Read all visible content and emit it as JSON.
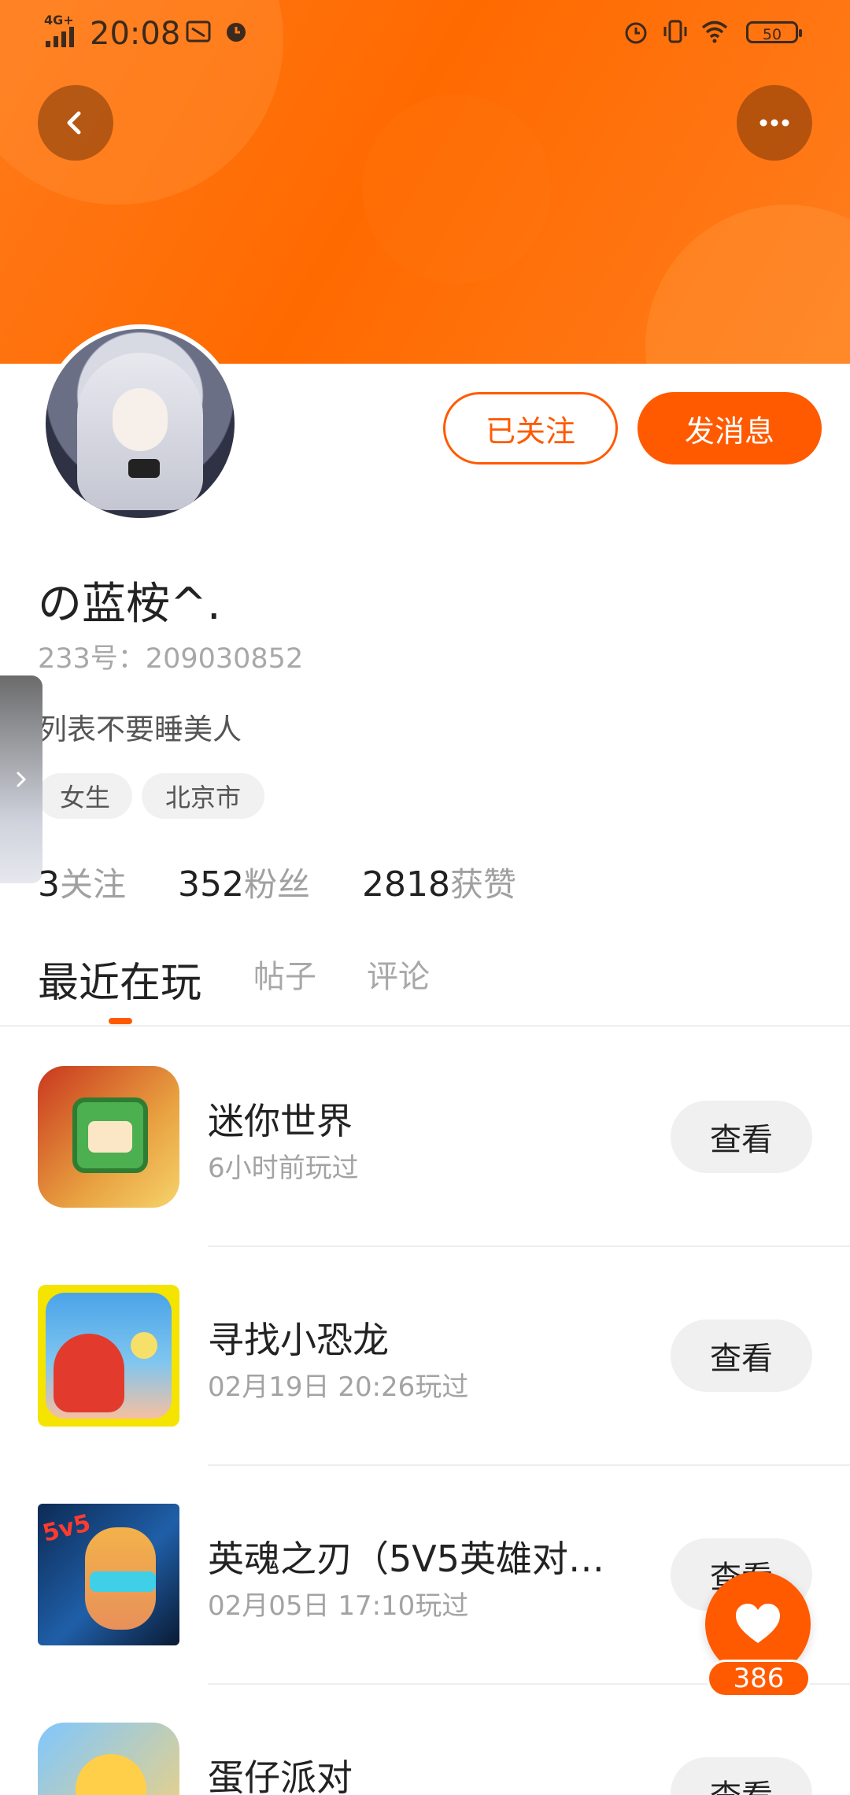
{
  "status_bar": {
    "network": "4G+",
    "time": "20:08",
    "battery": "50"
  },
  "header": {
    "back_icon": "chevron-left-icon",
    "more_icon": "more-dots-icon"
  },
  "profile": {
    "follow_label": "已关注",
    "message_label": "发消息",
    "name": "の蓝桉^.",
    "id_label": "233号：209030852",
    "bio": "列表不要睡美人",
    "tags": [
      "女生",
      "北京市"
    ],
    "stats": [
      {
        "value": "3",
        "label": "关注"
      },
      {
        "value": "352",
        "label": "粉丝"
      },
      {
        "value": "2818",
        "label": "获赞"
      }
    ]
  },
  "tabs": [
    {
      "label": "最近在玩",
      "active": true
    },
    {
      "label": "帖子",
      "active": false
    },
    {
      "label": "评论",
      "active": false
    }
  ],
  "games": [
    {
      "title": "迷你世界",
      "subtitle": "6小时前玩过",
      "button": "查看"
    },
    {
      "title": "寻找小恐龙",
      "subtitle": "02月19日 20:26玩过",
      "button": "查看"
    },
    {
      "title": "英魂之刃（5V5英雄对…",
      "subtitle": "02月05日 17:10玩过",
      "button": "查看"
    },
    {
      "title": "蛋仔派对",
      "subtitle": "",
      "button": "查看"
    }
  ],
  "game3_icon_text": "5v5",
  "fab": {
    "icon": "heart-icon",
    "count": "386"
  },
  "colors": {
    "accent": "#ff5a00",
    "banner": "#ff6a00"
  }
}
